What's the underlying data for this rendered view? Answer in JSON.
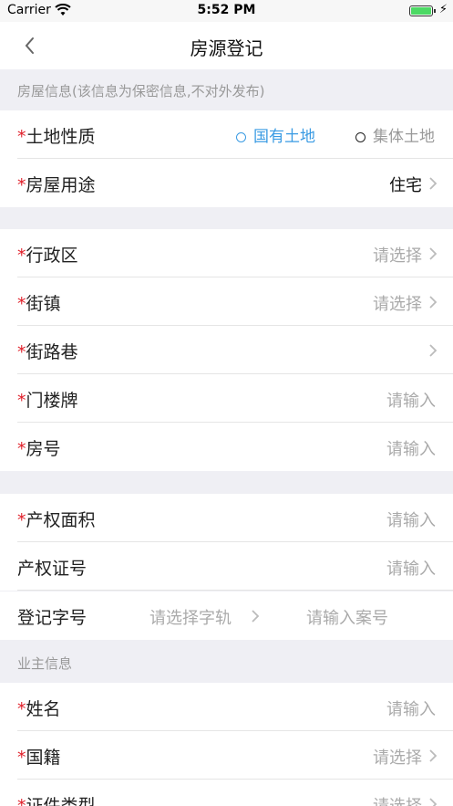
{
  "status_bar": {
    "carrier": "Carrier",
    "time": "5:52 PM"
  },
  "nav": {
    "title": "房源登记"
  },
  "section_house": {
    "header": "房屋信息(该信息为保密信息,不对外发布)"
  },
  "land_nature": {
    "label": "土地性质",
    "option_state": "国有土地",
    "option_collective": "集体土地"
  },
  "house_use": {
    "label": "房屋用途",
    "value": "住宅"
  },
  "district": {
    "label": "行政区",
    "value": "请选择"
  },
  "town": {
    "label": "街镇",
    "value": "请选择"
  },
  "street": {
    "label": "街路巷"
  },
  "door_plate": {
    "label": "门楼牌",
    "placeholder": "请输入"
  },
  "room_no": {
    "label": "房号",
    "placeholder": "请输入"
  },
  "area": {
    "label": "产权面积",
    "placeholder": "请输入"
  },
  "cert_no": {
    "label": "产权证号",
    "placeholder": "请输入"
  },
  "reg_no": {
    "label": "登记字号",
    "select": "请选择字轨",
    "placeholder": "请输入案号"
  },
  "section_owner": {
    "header": "业主信息"
  },
  "owner_name": {
    "label": "姓名",
    "placeholder": "请输入"
  },
  "nationality": {
    "label": "国籍",
    "value": "请选择"
  },
  "id_type": {
    "label": "证件类型",
    "value": "请选择"
  },
  "required_mark": "*",
  "colors": {
    "accent": "#3a9be3",
    "required": "#e0202a",
    "placeholder": "#aaaaaa"
  }
}
